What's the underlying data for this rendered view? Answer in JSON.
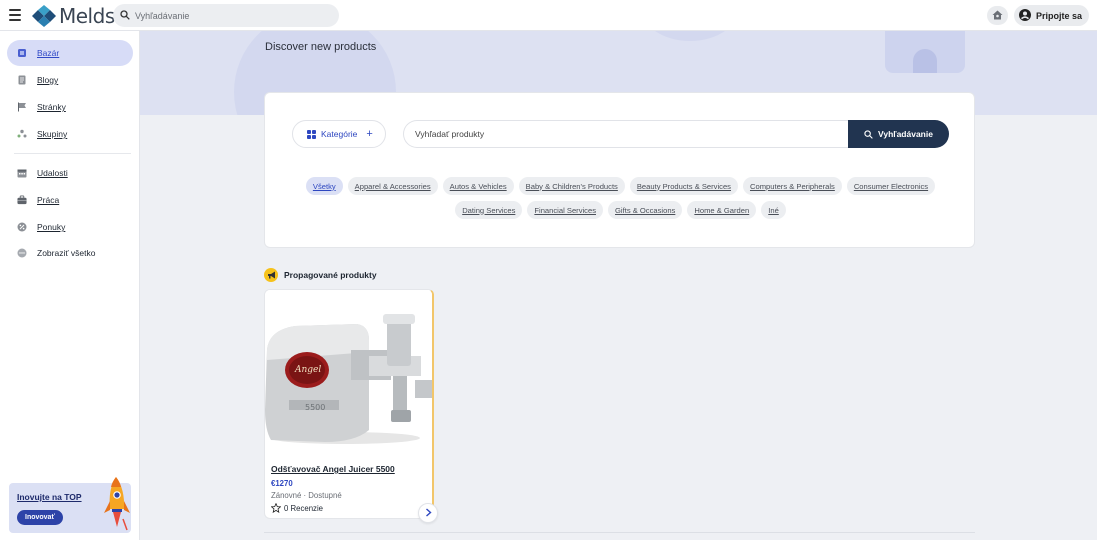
{
  "app": {
    "logo_text": "Melds"
  },
  "topbar": {
    "search_placeholder": "Vyhľadávanie",
    "login_label": "Pripojte sa",
    "icons": [
      "menu-icon",
      "search-icon",
      "home-icon",
      "user-circle-icon"
    ]
  },
  "sidebar": {
    "items": [
      {
        "label": "Bazár",
        "icon": "store-icon",
        "active": true
      },
      {
        "label": "Blogy",
        "icon": "document-icon",
        "active": false
      },
      {
        "label": "Stránky",
        "icon": "flag-icon",
        "active": false
      },
      {
        "label": "Skupiny",
        "icon": "group-icon",
        "active": false
      },
      {
        "label": "Udalosti",
        "icon": "calendar-icon",
        "active": false
      },
      {
        "label": "Práca",
        "icon": "briefcase-icon",
        "active": false
      },
      {
        "label": "Ponuky",
        "icon": "offer-icon",
        "active": false
      },
      {
        "label": "Zobraziť všetko",
        "icon": "more-icon",
        "active": false
      }
    ],
    "promo": {
      "title": "Inovujte na TOP",
      "button": "Inovovať"
    }
  },
  "hero": {
    "title": "Discover new products"
  },
  "filter": {
    "category_button": "Kategórie",
    "search_placeholder": "Vyhľadať produkty",
    "search_button": "Vyhľadávanie",
    "chips_row1": [
      "Všetky",
      "Apparel & Accessories",
      "Autos & Vehicles",
      "Baby & Children's Products",
      "Beauty Products & Services",
      "Computers & Peripherals",
      "Consumer Electronics"
    ],
    "chips_row2": [
      "Dating Services",
      "Financial Services",
      "Gifts & Occasions",
      "Home & Garden",
      "Iné"
    ],
    "active_chip": "Všetky"
  },
  "promoted": {
    "title": "Propagované produkty",
    "products": [
      {
        "name": "Odšťavovač Angel Juicer 5500",
        "price": "€1270",
        "condition": "Zánovné",
        "availability": "Dostupné",
        "reviews": "0 Recenzie"
      }
    ]
  },
  "colors": {
    "accent": "#2e47c0",
    "dark_button": "#213450",
    "hero_bg": "#dde1f2",
    "badge": "#f6c21b"
  }
}
